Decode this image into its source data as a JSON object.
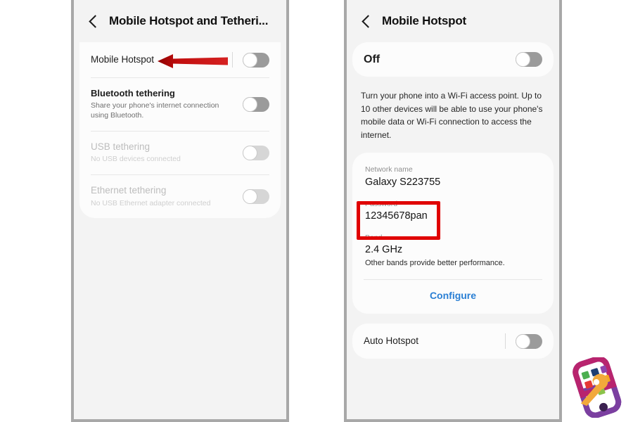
{
  "screen_left": {
    "header": {
      "back_icon": "back-chevron-icon",
      "title": "Mobile Hotspot and Tetheri..."
    },
    "rows": [
      {
        "title": "Mobile Hotspot",
        "subtitle": "",
        "toggle_state": "off",
        "disabled": false
      },
      {
        "title": "Bluetooth tethering",
        "subtitle": "Share your phone's internet connection using Bluetooth.",
        "toggle_state": "off",
        "disabled": false
      },
      {
        "title": "USB tethering",
        "subtitle": "No USB devices connected",
        "toggle_state": "off",
        "disabled": true
      },
      {
        "title": "Ethernet tethering",
        "subtitle": "No USB Ethernet adapter connected",
        "toggle_state": "off",
        "disabled": true
      }
    ]
  },
  "screen_right": {
    "header": {
      "back_icon": "back-chevron-icon",
      "title": "Mobile Hotspot"
    },
    "master_toggle": {
      "label": "Off",
      "toggle_state": "off"
    },
    "description": "Turn your phone into a Wi-Fi access point. Up to 10 other devices will be able to use your phone's mobile data or Wi-Fi connection to access the internet.",
    "fields": [
      {
        "label": "Network name",
        "value": "Galaxy S223755",
        "note": ""
      },
      {
        "label": "Password",
        "value": "12345678pan",
        "note": ""
      },
      {
        "label": "Band",
        "value": "2.4 GHz",
        "note": "Other bands provide better performance."
      }
    ],
    "configure_label": "Configure",
    "auto_hotspot": {
      "label": "Auto Hotspot",
      "toggle_state": "off"
    }
  },
  "annotations": {
    "arrow": {
      "name": "red-arrow-pointing-to-mobile-hotspot",
      "color": "#c00000"
    },
    "highlight_box": {
      "name": "red-box-around-password",
      "color": "#e00000"
    }
  },
  "watermark": {
    "name": "phone-with-wrench-logo",
    "colors": {
      "phone_body": "#b8246e",
      "phone_body_alt": "#7b3fa0",
      "wrench": "#f2a93b"
    }
  }
}
